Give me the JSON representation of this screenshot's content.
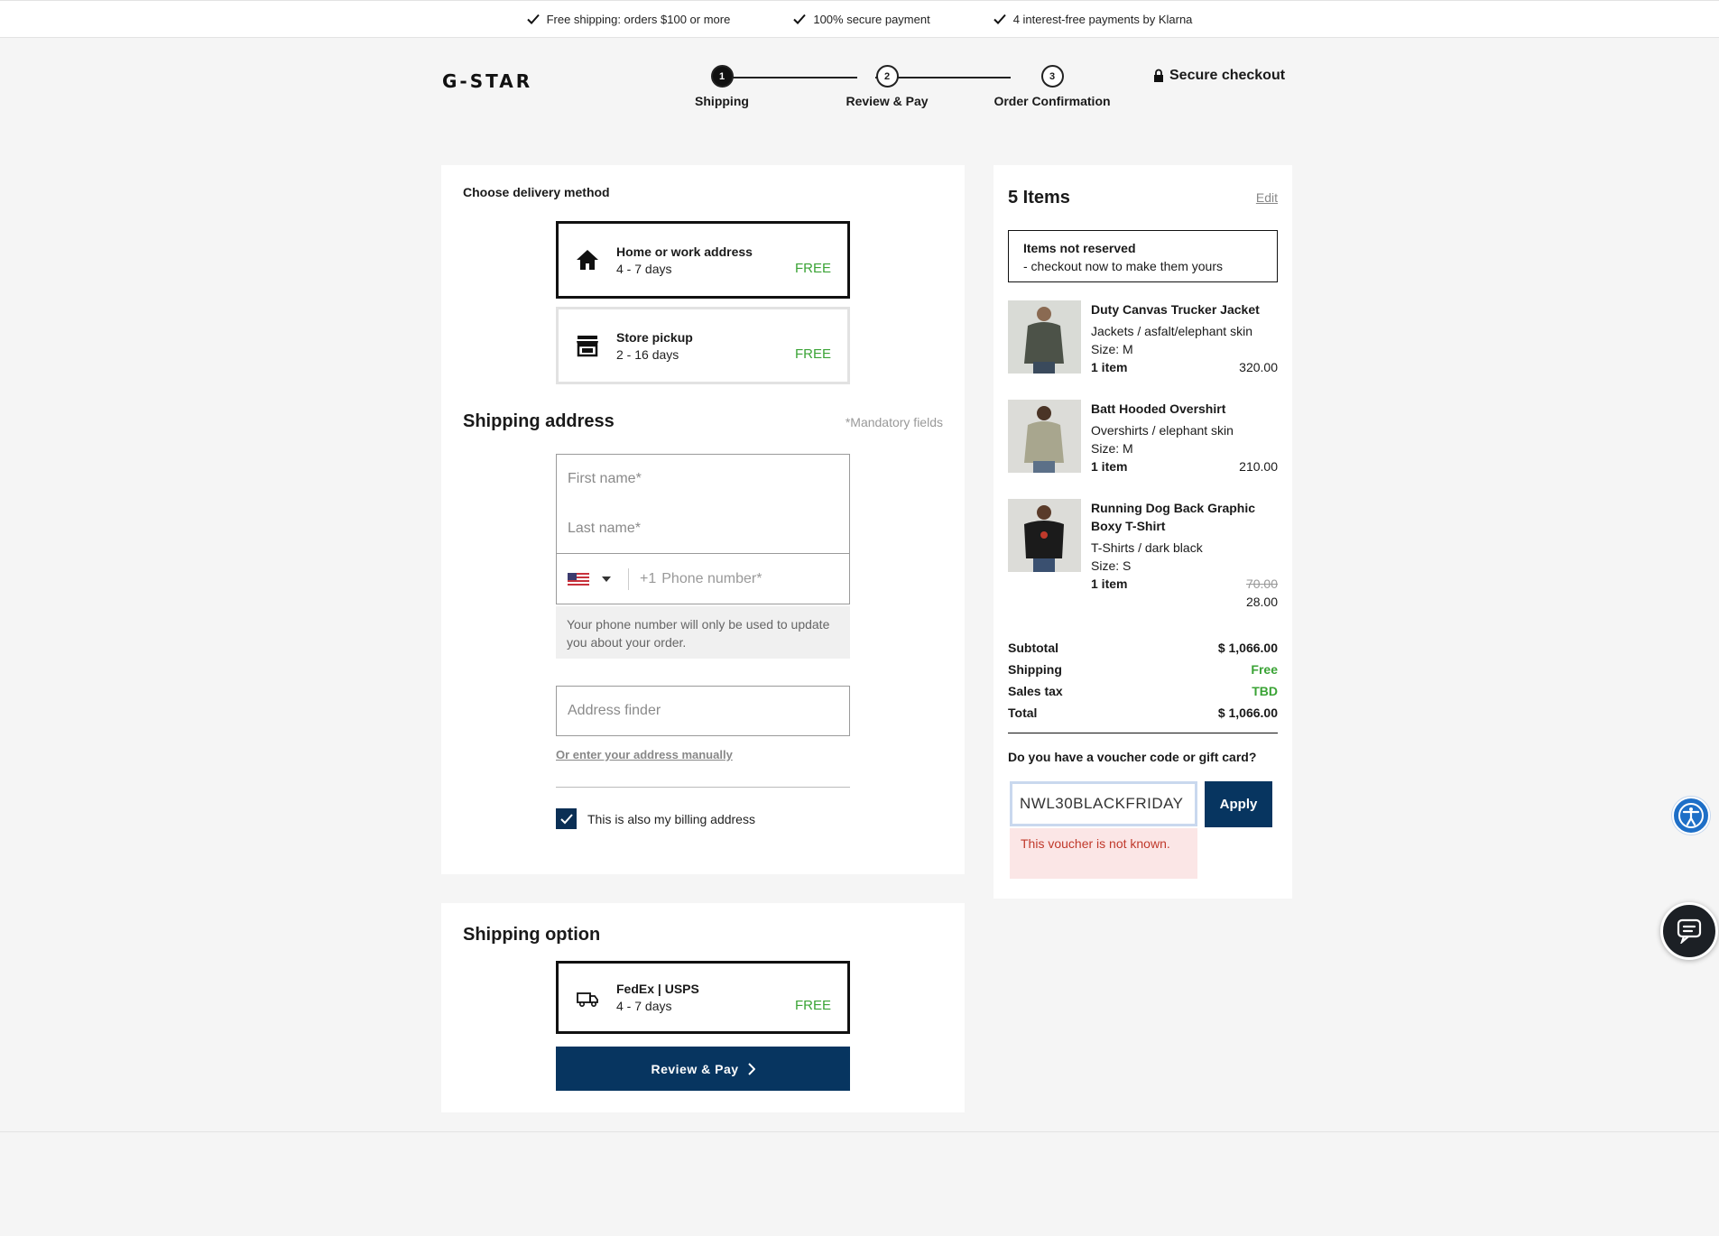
{
  "usp": {
    "shipping": "Free shipping: orders $100 or more",
    "secure": "100% secure payment",
    "klarna": "4 interest-free payments by Klarna"
  },
  "header": {
    "logo": "G-STAR",
    "secure_checkout": "Secure checkout",
    "steps": [
      {
        "num": "1",
        "label": "Shipping"
      },
      {
        "num": "2",
        "label": "Review & Pay"
      },
      {
        "num": "3",
        "label": "Order Confirmation"
      }
    ]
  },
  "delivery": {
    "title": "Choose delivery method",
    "options": [
      {
        "title": "Home or work address",
        "days": "4 - 7 days",
        "price": "FREE",
        "icon": "house-icon"
      },
      {
        "title": "Store pickup",
        "days": "2 - 16 days",
        "price": "FREE",
        "icon": "store-icon"
      }
    ]
  },
  "address": {
    "title": "Shipping address",
    "mandatory": "*Mandatory fields",
    "first_name_placeholder": "First name*",
    "last_name_placeholder": "Last name*",
    "phone_prefix": "+1",
    "phone_placeholder": "Phone number*",
    "phone_note": "Your phone number will only be used to update you about your order.",
    "finder_placeholder": "Address finder",
    "manual_link": "Or enter your address manually",
    "billing_label": "This is also my billing address"
  },
  "shipping_option": {
    "title": "Shipping option",
    "carrier": "FedEx | USPS",
    "days": "4 - 7 days",
    "price": "FREE",
    "button": "Review & Pay"
  },
  "cart": {
    "title": "5 Items",
    "edit": "Edit",
    "notice_title": "Items not reserved",
    "notice_text": "- checkout now to make them yours",
    "products": [
      {
        "name": "Duty Canvas Trucker Jacket",
        "category": "Jackets / asfalt/elephant skin",
        "size": "Size: M",
        "qty": "1  item",
        "price": "320.00",
        "old_price": ""
      },
      {
        "name": "Batt Hooded Overshirt",
        "category": "Overshirts / elephant skin",
        "size": "Size: M",
        "qty": "1  item",
        "price": "210.00",
        "old_price": ""
      },
      {
        "name": "Running Dog Back Graphic Boxy T-Shirt",
        "category": "T-Shirts / dark black",
        "size": "Size: S",
        "qty": "1  item",
        "price": "28.00",
        "old_price": "70.00"
      }
    ],
    "totals": {
      "subtotal_label": "Subtotal",
      "subtotal": "$ 1,066.00",
      "shipping_label": "Shipping",
      "shipping": "Free",
      "tax_label": "Sales tax",
      "tax": "TBD",
      "total_label": "Total",
      "total": "$ 1,066.00"
    },
    "voucher_question": "Do you have a voucher code or gift card?",
    "voucher_value": "NWL30BLACKFRIDAY",
    "apply": "Apply",
    "voucher_error": "This voucher is not known."
  },
  "colors": {
    "primary": "#073560",
    "free_green": "#3aa335",
    "error_red": "#c0392b"
  }
}
